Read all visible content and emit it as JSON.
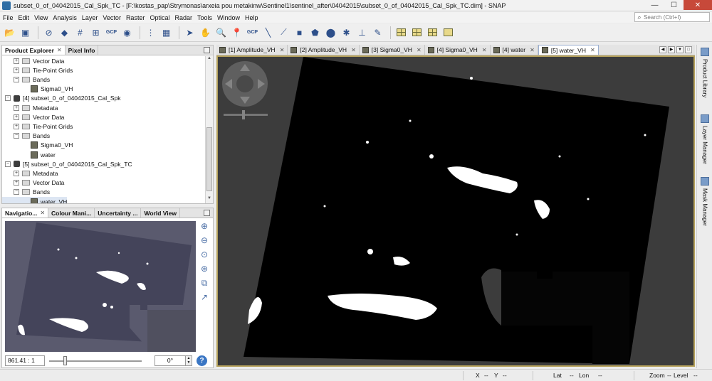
{
  "window": {
    "title": "subset_0_of_04042015_Cal_Spk_TC - [F:\\kostas_pap\\Strymonas\\arxeia pou metakinw\\Sentinel1\\sentinel_after\\04042015\\subset_0_of_04042015_Cal_Spk_TC.dim] - SNAP",
    "minimize": "—",
    "maximize": "☐",
    "close": "✕"
  },
  "menu": [
    "File",
    "Edit",
    "View",
    "Analysis",
    "Layer",
    "Vector",
    "Raster",
    "Optical",
    "Radar",
    "Tools",
    "Window",
    "Help"
  ],
  "search": {
    "placeholder": "Search (Ctrl+I)",
    "icon": "search-icon"
  },
  "toolbar": {
    "gcp1": "GCP",
    "gcp2": "GCP"
  },
  "product_explorer": {
    "tabs": [
      "Product Explorer",
      "Pixel Info"
    ],
    "rows": [
      {
        "label": "Vector Data",
        "kind": "folder",
        "level": 1,
        "exp": "+"
      },
      {
        "label": "Tie-Point Grids",
        "kind": "folder",
        "level": 1,
        "exp": "+"
      },
      {
        "label": "Bands",
        "kind": "folder",
        "level": 1,
        "exp": "−"
      },
      {
        "label": "Sigma0_VH",
        "kind": "band",
        "level": 2,
        "exp": ""
      },
      {
        "label": "[4] subset_0_of_04042015_Cal_Spk",
        "kind": "product",
        "level": 0,
        "exp": "−"
      },
      {
        "label": "Metadata",
        "kind": "folder",
        "level": 1,
        "exp": "+"
      },
      {
        "label": "Vector Data",
        "kind": "folder",
        "level": 1,
        "exp": "+"
      },
      {
        "label": "Tie-Point Grids",
        "kind": "folder",
        "level": 1,
        "exp": "+"
      },
      {
        "label": "Bands",
        "kind": "folder",
        "level": 1,
        "exp": "−"
      },
      {
        "label": "Sigma0_VH",
        "kind": "band",
        "level": 2,
        "exp": ""
      },
      {
        "label": "water",
        "kind": "band",
        "level": 2,
        "exp": ""
      },
      {
        "label": "[5] subset_0_of_04042015_Cal_Spk_TC",
        "kind": "product",
        "level": 0,
        "exp": "−"
      },
      {
        "label": "Metadata",
        "kind": "folder",
        "level": 1,
        "exp": "+"
      },
      {
        "label": "Vector Data",
        "kind": "folder",
        "level": 1,
        "exp": "+"
      },
      {
        "label": "Bands",
        "kind": "folder",
        "level": 1,
        "exp": "−"
      },
      {
        "label": "water_VH",
        "kind": "band",
        "level": 2,
        "exp": "",
        "selected": true
      }
    ]
  },
  "navigation": {
    "tabs": [
      "Navigatio...",
      "Colour Mani...",
      "Uncertainty ...",
      "World View"
    ],
    "scale": "861.41 : 1",
    "angle": "0°"
  },
  "documents": {
    "tabs": [
      {
        "label": "[1] Amplitude_VH",
        "active": false
      },
      {
        "label": "[2] Amplitude_VH",
        "active": false
      },
      {
        "label": "[3] Sigma0_VH",
        "active": false
      },
      {
        "label": "[4] Sigma0_VH",
        "active": false
      },
      {
        "label": "[4] water",
        "active": false
      },
      {
        "label": "[5] water_VH",
        "active": true
      }
    ]
  },
  "right_rail": [
    "Product Library",
    "Layer Manager",
    "Mask Manager"
  ],
  "status": {
    "x_label": "X",
    "x_val": "--",
    "y_label": "Y",
    "y_val": "--",
    "lat_label": "Lat",
    "lat_val": "--",
    "lon_label": "Lon",
    "lon_val": "--",
    "zoom_label": "Zoom",
    "zoom_val": "--",
    "level_label": "Level",
    "level_val": "--"
  },
  "colors": {
    "accent": "#b6a25c",
    "image_background": "#3c3c3c",
    "scene": "#000000",
    "water": "#ffffff",
    "nav_scene": "#44445a"
  }
}
